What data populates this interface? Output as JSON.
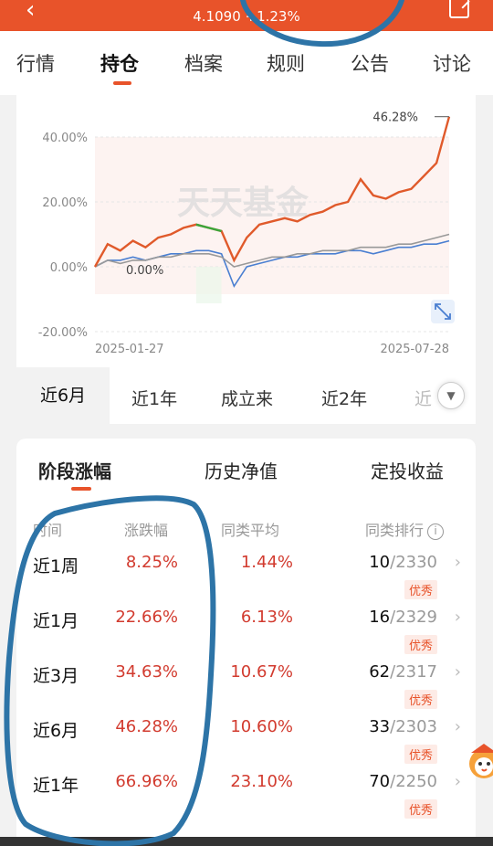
{
  "header": {
    "back_icon": "chevron-left-icon",
    "price_text": "4.1090 +1.23%",
    "share_icon": "share-icon"
  },
  "tabs": [
    "行情",
    "持仓",
    "档案",
    "规则",
    "公告",
    "讨论"
  ],
  "active_tab": "持仓",
  "chart": {
    "watermark": "天天基金",
    "end_label": "46.28%",
    "start_label": "0.00%",
    "expand_icon": "expand-icon",
    "colors": {
      "fund": "#e05a2b",
      "avg": "#999999",
      "index": "#4a7fd1",
      "highlight": "#3aa63a"
    }
  },
  "chart_data": {
    "type": "line",
    "x_start": "2025-01-27",
    "x_end": "2025-07-28",
    "yticks": [
      "40.00%",
      "20.00%",
      "0.00%",
      "-20.00%"
    ],
    "ylim": [
      -20,
      45
    ],
    "series": [
      {
        "values": [
          0,
          7,
          5,
          8,
          6,
          9,
          10,
          12,
          13,
          12,
          11,
          2,
          9,
          13,
          14,
          15,
          14,
          16,
          17,
          19,
          20,
          27,
          22,
          21,
          23,
          24,
          28,
          32,
          46.28
        ]
      },
      {
        "values": [
          0,
          2,
          1,
          2,
          2,
          3,
          3,
          4,
          4,
          4,
          3,
          0,
          1,
          2,
          3,
          3,
          4,
          4,
          5,
          5,
          5,
          6,
          6,
          6,
          7,
          7,
          8,
          9,
          10
        ]
      },
      {
        "values": [
          0,
          2,
          2,
          3,
          2,
          3,
          4,
          4,
          5,
          5,
          4,
          -6,
          0,
          1,
          2,
          3,
          3,
          4,
          4,
          4,
          5,
          5,
          4,
          5,
          6,
          6,
          7,
          7,
          8
        ]
      }
    ]
  },
  "periods": [
    "近6月",
    "近1年",
    "成立来",
    "近2年",
    "近"
  ],
  "active_period": "近6月",
  "returns": {
    "tabs": [
      "阶段涨幅",
      "历史净值",
      "定投收益"
    ],
    "headers": [
      "时间",
      "涨跌幅",
      "同类平均",
      "同类排行"
    ],
    "rows": [
      {
        "label": "近1周",
        "change": "8.25%",
        "avg": "1.44%",
        "rank": "10",
        "total": "/2330",
        "badge": "优秀"
      },
      {
        "label": "近1月",
        "change": "22.66%",
        "avg": "6.13%",
        "rank": "16",
        "total": "/2329",
        "badge": "优秀"
      },
      {
        "label": "近3月",
        "change": "34.63%",
        "avg": "10.67%",
        "rank": "62",
        "total": "/2317",
        "badge": "优秀"
      },
      {
        "label": "近6月",
        "change": "46.28%",
        "avg": "10.60%",
        "rank": "33",
        "total": "/2303",
        "badge": "优秀"
      },
      {
        "label": "近1年",
        "change": "66.96%",
        "avg": "23.10%",
        "rank": "70",
        "total": "/2250",
        "badge": "优秀"
      }
    ]
  }
}
